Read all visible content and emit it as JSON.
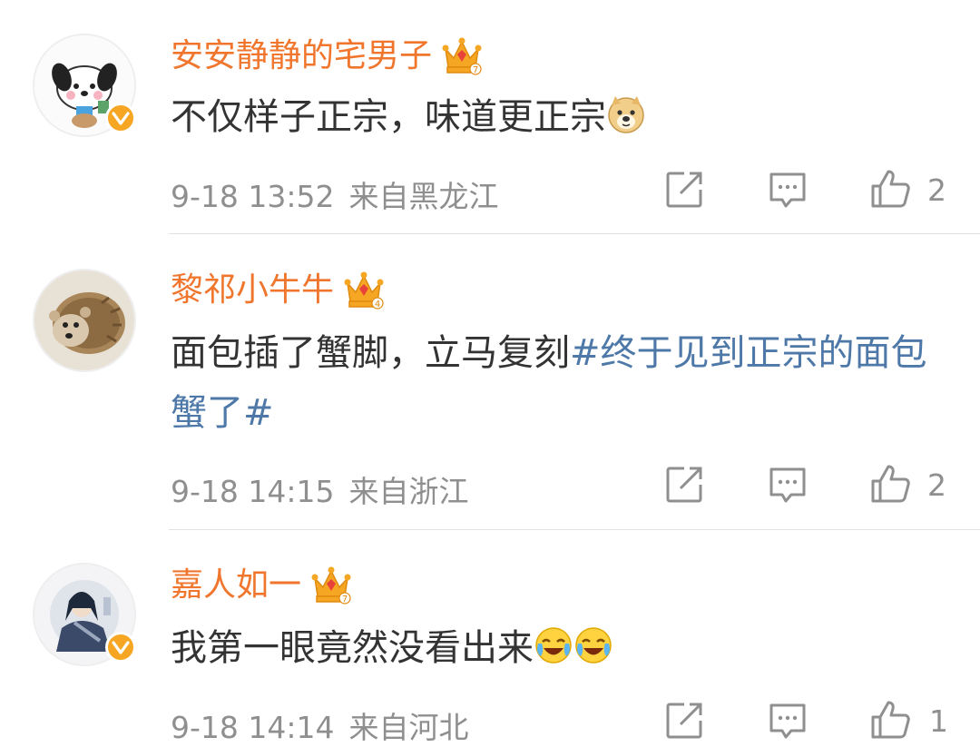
{
  "comments": [
    {
      "username": "安安静静的宅男子",
      "text_main": "不仅样子正宗，味道更正宗",
      "text_topic": "",
      "emoji": [
        "doge-emoji"
      ],
      "date": "9-18 13:52",
      "location": "来自黑龙江",
      "likes": "2",
      "verified": true,
      "crown_level": "7"
    },
    {
      "username": "黎祁小牛牛",
      "text_main": "面包插了蟹脚，立马复刻",
      "text_topic": "#终于见到正宗的面包蟹了#",
      "emoji": [],
      "date": "9-18 14:15",
      "location": "来自浙江",
      "likes": "2",
      "verified": false,
      "crown_level": "4"
    },
    {
      "username": "嘉人如一",
      "text_main": "我第一眼竟然没看出来",
      "text_topic": "",
      "emoji": [
        "laugh-cry-emoji",
        "laugh-cry-emoji"
      ],
      "date": "9-18 14:14",
      "location": "来自河北",
      "likes": "1",
      "verified": true,
      "crown_level": "7"
    }
  ],
  "colors": {
    "username": "#f0762d",
    "topic": "#4d78a8",
    "meta": "#8f8f8f",
    "verified_badge": "#f6a623"
  },
  "icons": [
    "repost-icon",
    "comment-icon",
    "like-icon",
    "crown-icon",
    "verified-icon"
  ]
}
